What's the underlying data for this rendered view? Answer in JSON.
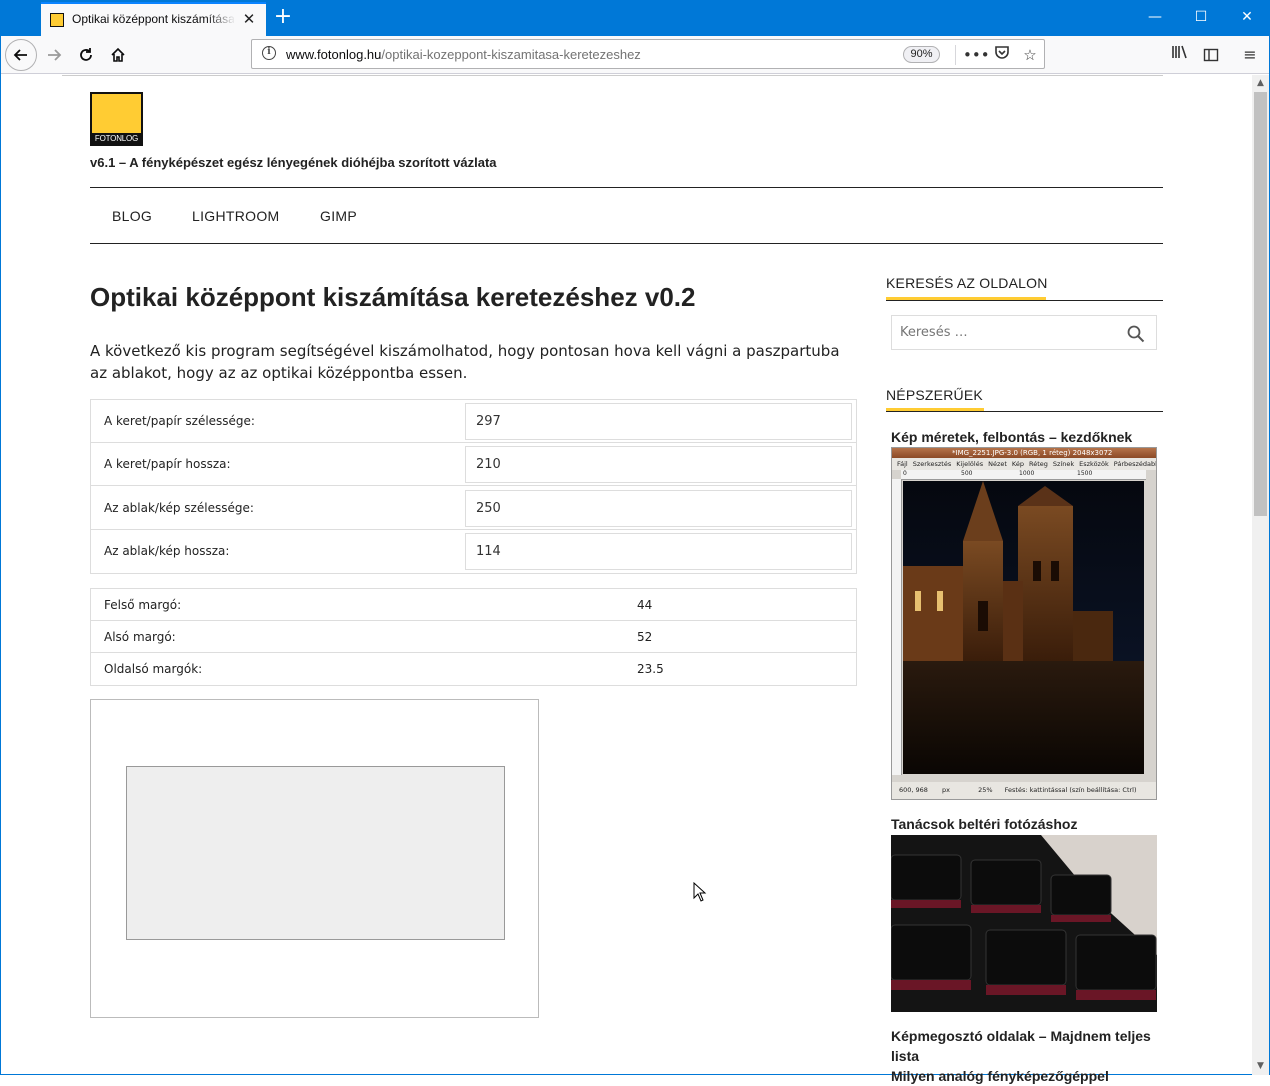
{
  "browser": {
    "tab_title": "Optikai középpont kiszámítása",
    "tab_close": "✕",
    "new_tab": "+",
    "url_host": "www.fotonlog.hu",
    "url_path": "/optikai-kozeppont-kiszamitasa-keretezeshez",
    "zoom": "90%",
    "controls": {
      "minimize": "—",
      "maximize": "☐",
      "close": "✕"
    },
    "icons": {
      "back": "back-arrow-icon",
      "forward": "forward-arrow-icon",
      "reload": "reload-icon",
      "home": "home-icon",
      "info": "info-icon",
      "more": "more-dots-icon",
      "pocket": "pocket-icon",
      "bookmark": "star-icon",
      "library": "library-icon",
      "sidebar": "sidebar-icon",
      "menu": "hamburger-menu-icon"
    }
  },
  "site": {
    "logo_text": "FOTONLOG",
    "tagline": "v6.1 – A fényképészet egész lényegének dióhéjba szorított vázlata",
    "menu": [
      "BLOG",
      "LIGHTROOM",
      "GIMP"
    ]
  },
  "article": {
    "title": "Optikai középpont kiszámítása keretezéshez v0.2",
    "intro": "A következő kis program segítségével kiszámolhatod, hogy pontosan hova kell vágni a paszpartuba az ablakot, hogy az az optikai középpontba essen.",
    "inputs": [
      {
        "label": "A keret/papír szélessége:",
        "value": "297"
      },
      {
        "label": "A keret/papír hossza:",
        "value": "210"
      },
      {
        "label": "Az ablak/kép szélessége:",
        "value": "250"
      },
      {
        "label": "Az ablak/kép hossza:",
        "value": "114"
      }
    ],
    "results": [
      {
        "label": "Felső margó:",
        "value": "44"
      },
      {
        "label": "Alsó margó:",
        "value": "52"
      },
      {
        "label": "Oldalsó margók:",
        "value": "23.5"
      }
    ]
  },
  "sidebar": {
    "search_title": "KERESÉS AZ OLDALON",
    "search_placeholder": "Keresés …",
    "popular_title": "NÉPSZERŰEK",
    "posts": [
      "Kép méretek, felbontás – kezdőknek",
      "Tanácsok beltéri fotózáshoz",
      "Képmegosztó oldalak – Majdnem teljes lista",
      "Milyen analóg fényképezőgéppel"
    ],
    "gimp_window_title": "*IMG_2251.JPG-3.0 (RGB, 1 réteg) 2048x3072",
    "gimp_menu": [
      "Fájl",
      "Szerkesztés",
      "Kijelölés",
      "Nézet",
      "Kép",
      "Réteg",
      "Színek",
      "Eszközök",
      "Párbeszédabl"
    ],
    "gimp_ruler": [
      "0",
      "500",
      "1000",
      "1500"
    ],
    "gimp_status": [
      "600, 968",
      "px",
      "25%",
      "Festés: kattintással (szín beállítása: Ctrl)"
    ]
  }
}
